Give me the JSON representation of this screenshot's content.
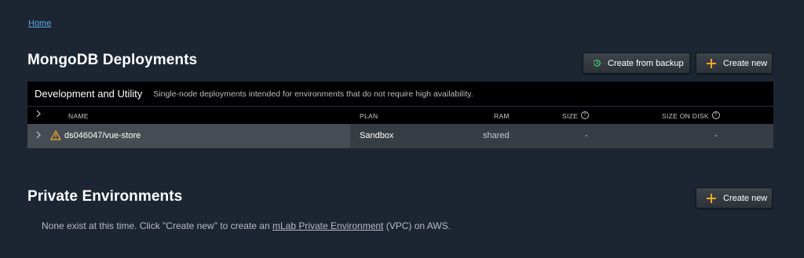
{
  "breadcrumb": {
    "home": "Home"
  },
  "deployments": {
    "title": "MongoDB Deployments",
    "backup_button": "Create from backup",
    "create_button": "Create new",
    "panel": {
      "title": "Development and Utility",
      "description": "Single-node deployments intended for environments that do not require high availability.",
      "columns": {
        "name": "NAME",
        "plan": "PLAN",
        "ram": "RAM",
        "size": "SIZE",
        "size_on_disk": "SIZE ON DISK"
      },
      "rows": [
        {
          "name": "ds046047/vue-store",
          "plan": "Sandbox",
          "ram": "shared",
          "size": "-",
          "size_on_disk": "-"
        }
      ]
    }
  },
  "private": {
    "title": "Private Environments",
    "create_button": "Create new",
    "message_before": "None exist at this time. Click \"Create new\" to create an ",
    "message_link": "mLab Private Environment",
    "message_after": " (VPC) on AWS."
  },
  "colors": {
    "accent_orange": "#f5a623",
    "backup_green": "#3fbf6b",
    "link_blue": "#5aa9e6"
  }
}
